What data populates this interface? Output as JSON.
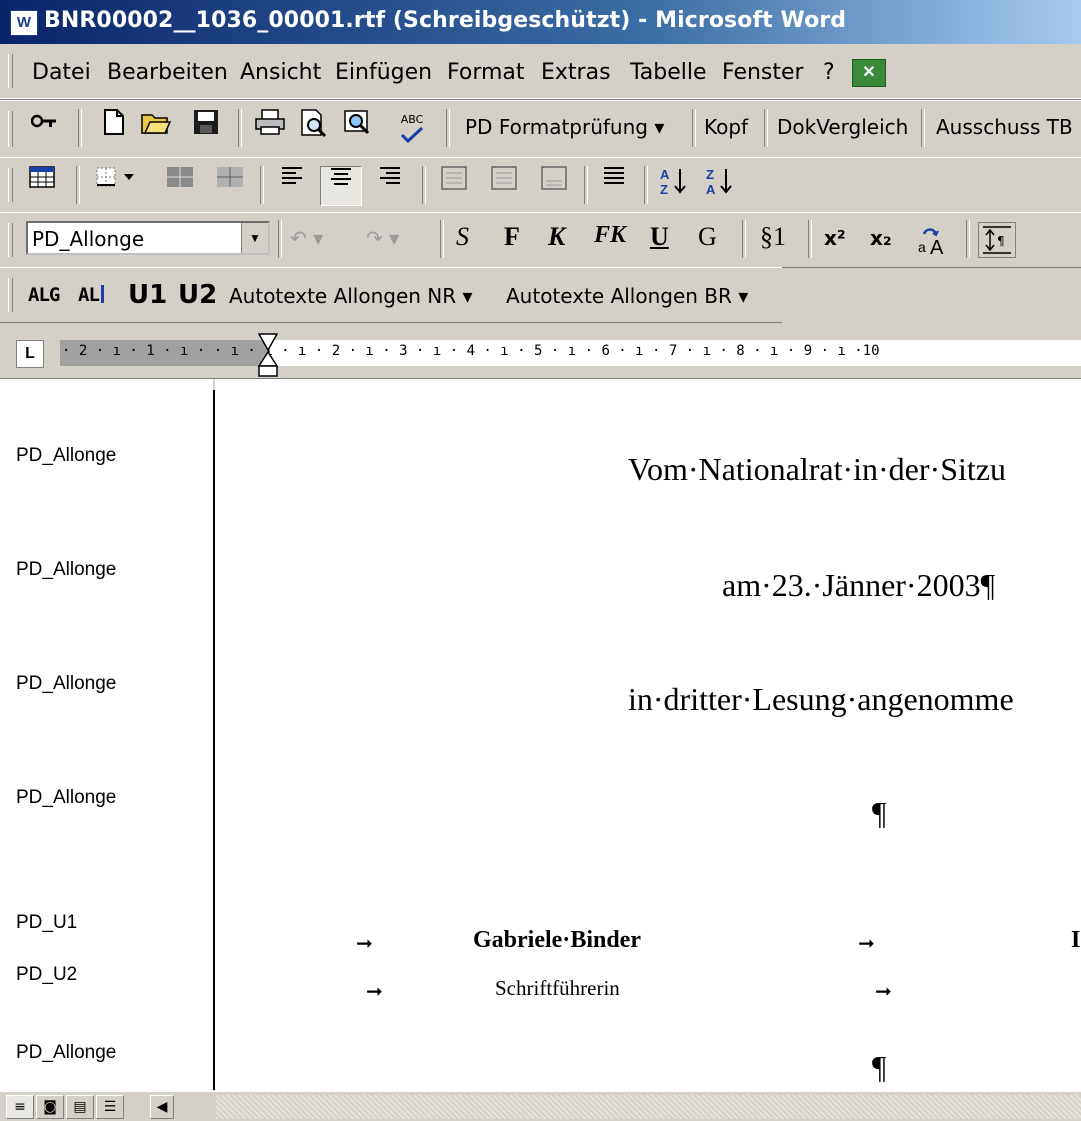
{
  "window": {
    "title": "BNR00002__1036_00001.rtf (Schreibgeschützt) - Microsoft Word",
    "app_icon": "word-icon"
  },
  "menu": {
    "items": [
      {
        "label": "Datei"
      },
      {
        "label": "Bearbeiten"
      },
      {
        "label": "Ansicht"
      },
      {
        "label": "Einfügen"
      },
      {
        "label": "Format"
      },
      {
        "label": "Extras"
      },
      {
        "label": "Tabelle"
      },
      {
        "label": "Fenster"
      },
      {
        "label": "?"
      }
    ],
    "extra_icon": "excel-icon"
  },
  "toolbar1": {
    "buttons": [
      "key-icon",
      "new-document-icon",
      "open-folder-icon",
      "save-icon",
      "print-icon",
      "print-preview-icon",
      "search-icon",
      "spellcheck-icon"
    ],
    "spell_glyph": "ABC",
    "pd_format_label": "PD Formatprüfung ▾",
    "kopf_label": "Kopf",
    "dokvergleich_label": "DokVergleich",
    "ausschuss_label": "Ausschuss TB"
  },
  "toolbar2": {
    "buttons": [
      "table-icon",
      "borders-icon",
      "shading-icon",
      "align-left-icon",
      "align-center-icon",
      "align-right-icon",
      "frame-icon",
      "justify-icon",
      "sort-ascending-icon",
      "sort-descending-icon"
    ],
    "sort_asc": "A↓Z",
    "sort_desc": "Z↓A"
  },
  "toolbar3": {
    "style_value": "PD_Allonge",
    "buttons": {
      "s": "S",
      "f": "F",
      "k": "K",
      "fk": "FK",
      "u": "U",
      "g": "G",
      "para": "§1",
      "sup": "x²",
      "sub": "x₂"
    }
  },
  "toolbar4": {
    "alg": "ALG",
    "al": "AL",
    "u1": "U1",
    "u2": "U2",
    "autotexte_nr": "Autotexte Allongen NR ▾",
    "autotexte_br": "Autotexte Allongen BR ▾"
  },
  "ruler": {
    "text": "· 2 · ı · 1 · ı ·   · ı · 1 · ı · 2 · ı · 3 · ı · 4 · ı · 5 · ı · 6 · ı · 7 · ı · 8 · ı · 9 · ı ·10"
  },
  "document": {
    "style_names": [
      "PD_Allonge",
      "PD_Allonge",
      "PD_Allonge",
      "PD_Allonge",
      "PD_U1",
      "PD_U2",
      "PD_Allonge"
    ],
    "line1": "Vom·Nationalrat·in·der·Sitzu",
    "line2": "am·23.·Jänner·2003¶",
    "line3": "in·dritter·Lesung·angenomme",
    "pilcrow1": "¶",
    "sig_name": "Gabriele·Binder",
    "sig_title": "Schriftführerin",
    "arrow": "➞",
    "trailing_char": "I",
    "pilcrow2": "¶"
  }
}
